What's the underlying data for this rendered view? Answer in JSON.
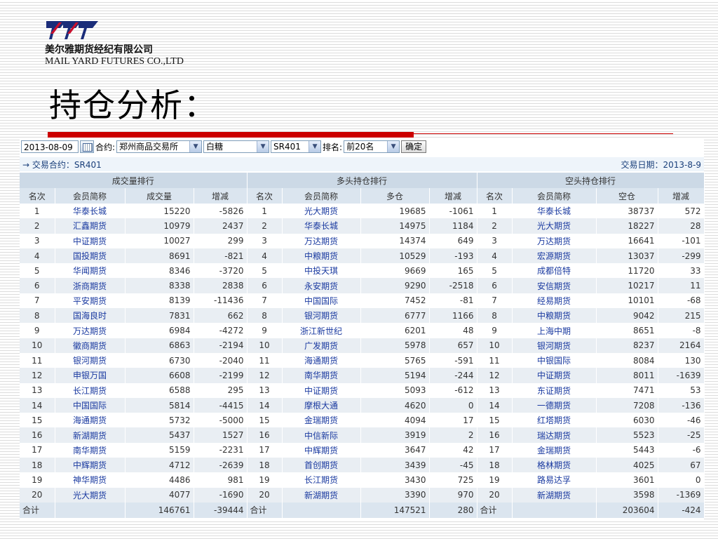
{
  "header": {
    "company_cn": "美尔雅期货经纪有限公司",
    "company_en": "MAIL YARD FUTURES CO.,LTD",
    "page_title": "持仓分析："
  },
  "colors": {
    "accent_red": "#cc0000",
    "link_blue": "#1a3aa0",
    "header_bg": "#ccd9e6",
    "stripe_bg": "#e9eef3"
  },
  "toolbar": {
    "date": "2013-08-09",
    "contract_label": "合约:",
    "exchange": "郑州商品交易所",
    "commodity": "白糖",
    "contract": "SR401",
    "rank_label": "排名:",
    "rank_option": "前20名",
    "ok_label": "确定"
  },
  "info": {
    "contract_text": "→ 交易合约：SR401",
    "trade_date_text": "交易日期：2013-8-9"
  },
  "table": {
    "groups": [
      "成交量排行",
      "多头持仓排行",
      "空头持仓排行"
    ],
    "columns": [
      "名次",
      "会员简称",
      "成交量",
      "增减",
      "名次",
      "会员简称",
      "多仓",
      "增减",
      "名次",
      "会员简称",
      "空仓",
      "增减"
    ],
    "rows": [
      [
        "1",
        "华泰长城",
        "15220",
        "-5826",
        "1",
        "光大期货",
        "19685",
        "-1061",
        "1",
        "华泰长城",
        "38737",
        "572"
      ],
      [
        "2",
        "汇鑫期货",
        "10979",
        "2437",
        "2",
        "华泰长城",
        "14975",
        "1184",
        "2",
        "光大期货",
        "18227",
        "28"
      ],
      [
        "3",
        "中证期货",
        "10027",
        "299",
        "3",
        "万达期货",
        "14374",
        "649",
        "3",
        "万达期货",
        "16641",
        "-101"
      ],
      [
        "4",
        "国投期货",
        "8691",
        "-821",
        "4",
        "中粮期货",
        "10529",
        "-193",
        "4",
        "宏源期货",
        "13037",
        "-299"
      ],
      [
        "5",
        "华闻期货",
        "8346",
        "-3720",
        "5",
        "中投天琪",
        "9669",
        "165",
        "5",
        "成都倍特",
        "11720",
        "33"
      ],
      [
        "6",
        "浙商期货",
        "8338",
        "2838",
        "6",
        "永安期货",
        "9290",
        "-2518",
        "6",
        "安信期货",
        "10217",
        "11"
      ],
      [
        "7",
        "平安期货",
        "8139",
        "-11436",
        "7",
        "中国国际",
        "7452",
        "-81",
        "7",
        "经易期货",
        "10101",
        "-68"
      ],
      [
        "8",
        "国海良时",
        "7831",
        "662",
        "8",
        "银河期货",
        "6777",
        "1166",
        "8",
        "中粮期货",
        "9042",
        "215"
      ],
      [
        "9",
        "万达期货",
        "6984",
        "-4272",
        "9",
        "浙江新世纪",
        "6201",
        "48",
        "9",
        "上海中期",
        "8651",
        "-8"
      ],
      [
        "10",
        "徽商期货",
        "6863",
        "-2194",
        "10",
        "广发期货",
        "5978",
        "657",
        "10",
        "银河期货",
        "8237",
        "2164"
      ],
      [
        "11",
        "银河期货",
        "6730",
        "-2040",
        "11",
        "海通期货",
        "5765",
        "-591",
        "11",
        "中银国际",
        "8084",
        "130"
      ],
      [
        "12",
        "申银万国",
        "6608",
        "-2199",
        "12",
        "南华期货",
        "5194",
        "-244",
        "12",
        "中证期货",
        "8011",
        "-1639"
      ],
      [
        "13",
        "长江期货",
        "6588",
        "295",
        "13",
        "中证期货",
        "5093",
        "-612",
        "13",
        "东证期货",
        "7471",
        "53"
      ],
      [
        "14",
        "中国国际",
        "5814",
        "-4415",
        "14",
        "摩根大通",
        "4620",
        "0",
        "14",
        "一德期货",
        "7208",
        "-136"
      ],
      [
        "15",
        "海通期货",
        "5732",
        "-5000",
        "15",
        "金瑞期货",
        "4094",
        "17",
        "15",
        "红塔期货",
        "6030",
        "-46"
      ],
      [
        "16",
        "新湖期货",
        "5437",
        "1527",
        "16",
        "中信新际",
        "3919",
        "2",
        "16",
        "瑞达期货",
        "5523",
        "-25"
      ],
      [
        "17",
        "南华期货",
        "5159",
        "-2231",
        "17",
        "中辉期货",
        "3647",
        "42",
        "17",
        "金瑞期货",
        "5443",
        "-6"
      ],
      [
        "18",
        "中辉期货",
        "4712",
        "-2639",
        "18",
        "首创期货",
        "3439",
        "-45",
        "18",
        "格林期货",
        "4025",
        "67"
      ],
      [
        "19",
        "神华期货",
        "4486",
        "981",
        "19",
        "长江期货",
        "3430",
        "725",
        "19",
        "路易达孚",
        "3601",
        "0"
      ],
      [
        "20",
        "光大期货",
        "4077",
        "-1690",
        "20",
        "新湖期货",
        "3390",
        "970",
        "20",
        "新湖期货",
        "3598",
        "-1369"
      ]
    ],
    "totals": [
      "合计",
      "",
      "146761",
      "-39444",
      "合计",
      "",
      "147521",
      "280",
      "合计",
      "",
      "203604",
      "-424"
    ]
  }
}
